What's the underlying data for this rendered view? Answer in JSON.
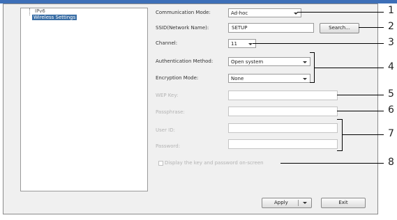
{
  "tree": {
    "items": [
      "IPv6",
      "Wireless Settings"
    ]
  },
  "form": {
    "communication_mode": {
      "label": "Communication Mode:",
      "value": "Ad-hoc"
    },
    "ssid": {
      "label": "SSID(Network Name):",
      "value": "SETUP",
      "search_label": "Search..."
    },
    "channel": {
      "label": "Channel:",
      "value": "11"
    },
    "authentication": {
      "label": "Authentication Method:",
      "value": "Open system"
    },
    "encryption": {
      "label": "Encryption Mode:",
      "value": "None"
    },
    "wep_key": {
      "label": "WEP Key:"
    },
    "passphrase": {
      "label": "Passphrase:"
    },
    "user_id": {
      "label": "User ID:"
    },
    "password": {
      "label": "Password:"
    },
    "display_checkbox": {
      "label": "Display the key and password on-screen",
      "checked": false
    }
  },
  "buttons": {
    "apply": "Apply",
    "exit": "Exit"
  },
  "callouts": [
    "1",
    "2",
    "3",
    "4",
    "5",
    "6",
    "7",
    "8"
  ]
}
